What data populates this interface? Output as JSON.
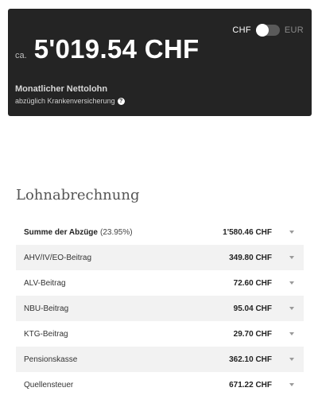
{
  "hero": {
    "currency_left": "CHF",
    "currency_right": "EUR",
    "prefix": "ca.",
    "amount": "5'019.54 CHF",
    "title": "Monatlicher Nettolohn",
    "subtitle": "abzüglich Krankenversicherung",
    "help_glyph": "?"
  },
  "section": {
    "title": "Lohnabrechnung"
  },
  "summary": {
    "label": "Summe der Abzüge",
    "pct": "(23.95%)",
    "value": "1'580.46 CHF"
  },
  "rows": [
    {
      "label": "AHV/IV/EO-Beitrag",
      "value": "349.80 CHF"
    },
    {
      "label": "ALV-Beitrag",
      "value": "72.60 CHF"
    },
    {
      "label": "NBU-Beitrag",
      "value": "95.04 CHF"
    },
    {
      "label": "KTG-Beitrag",
      "value": "29.70 CHF"
    },
    {
      "label": "Pensionskasse",
      "value": "362.10 CHF"
    },
    {
      "label": "Quellensteuer",
      "value": "671.22 CHF"
    }
  ]
}
